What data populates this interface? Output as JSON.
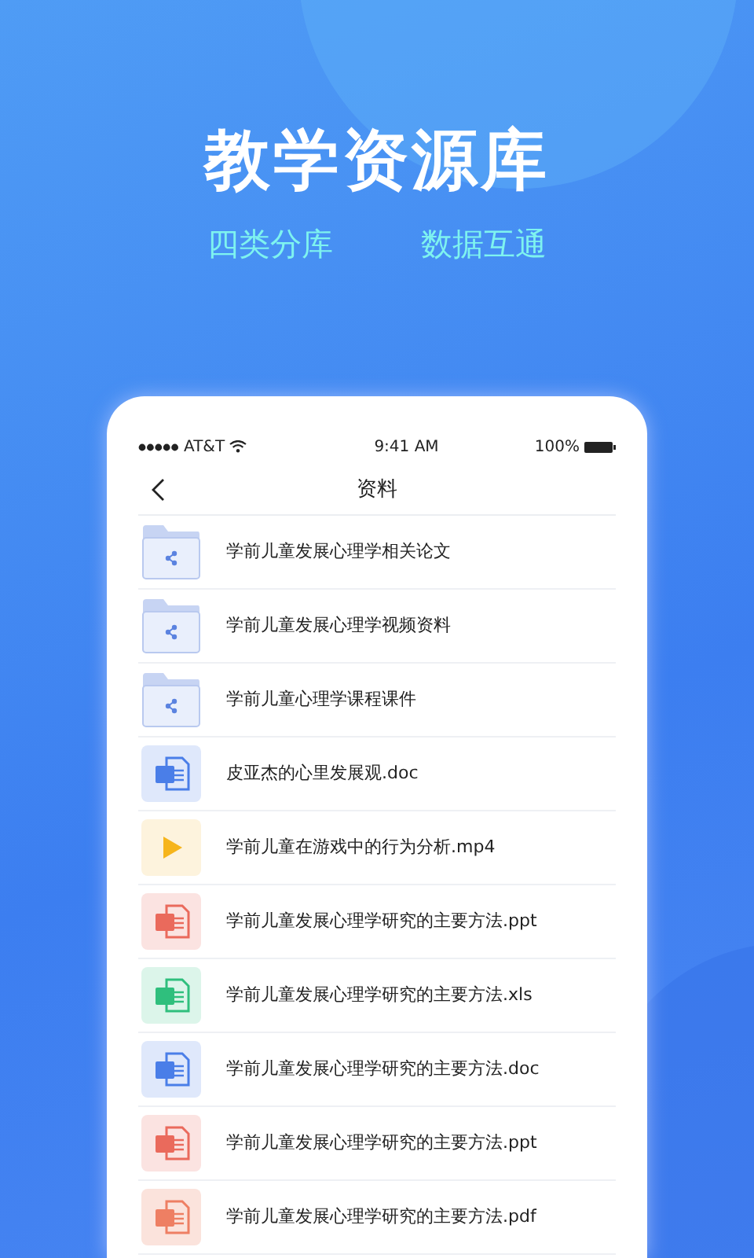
{
  "headline": "教学资源库",
  "taglines": [
    "四类分库",
    "数据互通"
  ],
  "status_bar": {
    "carrier": "AT&T",
    "time": "9:41 AM",
    "battery": "100%"
  },
  "nav": {
    "title": "资料"
  },
  "files": [
    {
      "kind": "folder",
      "name": "学前儿童发展心理学相关论文"
    },
    {
      "kind": "folder",
      "name": "学前儿童发展心理学视频资料"
    },
    {
      "kind": "folder",
      "name": "学前儿童心理学课程课件"
    },
    {
      "kind": "word",
      "name": "皮亚杰的心里发展观.doc"
    },
    {
      "kind": "video",
      "name": "学前儿童在游戏中的行为分析.mp4"
    },
    {
      "kind": "ppt",
      "name": "学前儿童发展心理学研究的主要方法.ppt"
    },
    {
      "kind": "excel",
      "name": "学前儿童发展心理学研究的主要方法.xls"
    },
    {
      "kind": "word",
      "name": "学前儿童发展心理学研究的主要方法.doc"
    },
    {
      "kind": "ppt",
      "name": "学前儿童发展心理学研究的主要方法.ppt"
    },
    {
      "kind": "pdf",
      "name": "学前儿童发展心理学研究的主要方法.pdf"
    }
  ]
}
